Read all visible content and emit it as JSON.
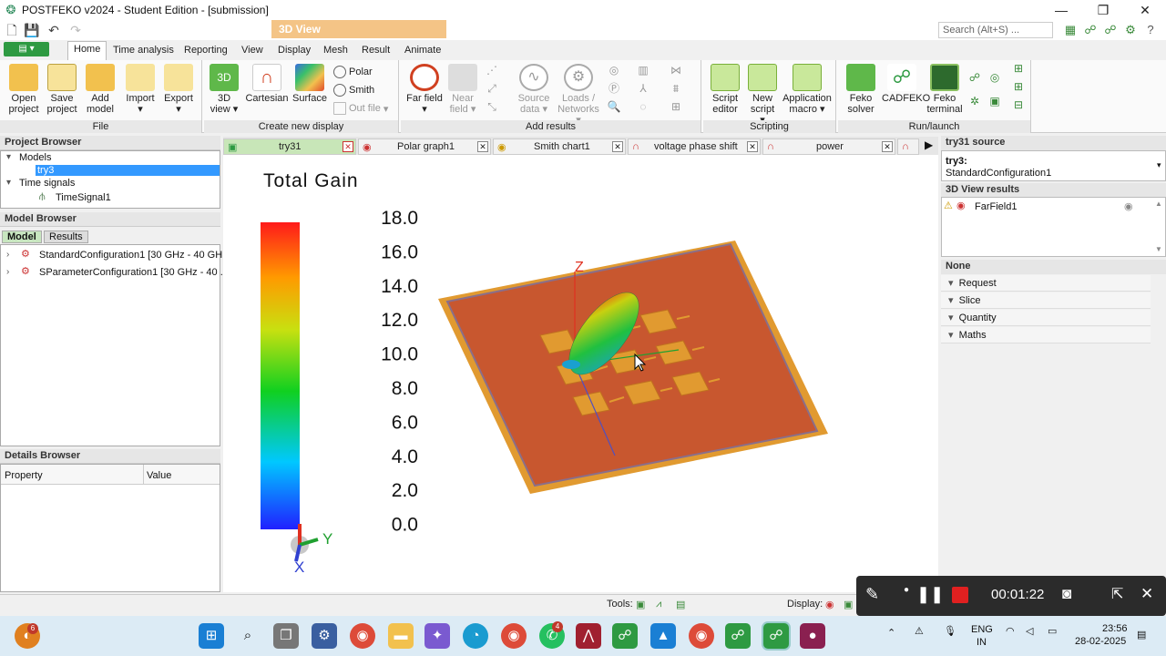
{
  "window": {
    "title": "POSTFEKO v2024 - Student Edition - [submission]",
    "context_tab": "3D View",
    "min_label": "—",
    "max_label": "❐",
    "close_label": "✕"
  },
  "search": {
    "placeholder": "Search (Alt+S) ..."
  },
  "ribbon_tabs": [
    "Home",
    "Time analysis",
    "Reporting",
    "View",
    "Display",
    "Mesh",
    "Result",
    "Animate"
  ],
  "ribbon": {
    "file_group": {
      "label": "File",
      "buttons": [
        "Open project",
        "Save project",
        "Add model",
        "Import",
        "Export"
      ]
    },
    "display_group": {
      "label": "Create new display",
      "buttons": [
        "3D view",
        "Cartesian",
        "Surface"
      ],
      "small": [
        "Polar",
        "Smith",
        "Out file"
      ]
    },
    "results_group": {
      "label": "Add results",
      "buttons": [
        "Far field",
        "Near field",
        "Source data",
        "Loads / Networks"
      ]
    },
    "scripting_group": {
      "label": "Scripting",
      "buttons": [
        "Script editor",
        "New script",
        "Application macro"
      ]
    },
    "run_group": {
      "label": "Run/launch",
      "buttons": [
        "Feko solver",
        "CADFEKO",
        "Feko terminal"
      ]
    }
  },
  "project_browser": {
    "title": "Project Browser",
    "models_label": "Models",
    "model_item": "try3",
    "time_signals_label": "Time signals",
    "time_signal_item": "TimeSignal1"
  },
  "model_browser": {
    "title": "Model Browser",
    "tabs": [
      "Model",
      "Results"
    ],
    "items": [
      "StandardConfiguration1 [30 GHz - 40 GH...",
      "SParameterConfiguration1 [30 GHz - 40 ..."
    ]
  },
  "details_browser": {
    "title": "Details Browser",
    "col_property": "Property",
    "col_value": "Value"
  },
  "doc_tabs": [
    "try31",
    "Polar graph1",
    "Smith chart1",
    "voltage phase shift",
    "power"
  ],
  "viewport": {
    "legend_title": "Total Gain",
    "legend_ticks": [
      "18.0",
      "16.0",
      "14.0",
      "12.0",
      "10.0",
      "8.0",
      "6.0",
      "4.0",
      "2.0",
      "0.0"
    ],
    "axis_z": "Z",
    "axis_y": "Y",
    "axis_x": "X"
  },
  "right_panel": {
    "source_title": "try31 source",
    "source_name": "try3:",
    "source_config": "StandardConfiguration1",
    "results_title": "3D View results",
    "result_item": "FarField1",
    "none_title": "None",
    "sections": [
      "Request",
      "Slice",
      "Quantity",
      "Maths"
    ]
  },
  "statusbar": {
    "tools_label": "Tools:",
    "display_label": "Display:"
  },
  "recorder": {
    "time": "00:01:22"
  },
  "taskbar": {
    "lang": "ENG",
    "region": "IN",
    "time": "23:56",
    "date": "28-02-2025",
    "badge_home": "6",
    "badge_whatsapp": "4"
  },
  "colors": {
    "accent_green": "#2e9a42",
    "selection": "#3399ff",
    "context_tab": "#f4c486",
    "plate": "#c8572f"
  }
}
